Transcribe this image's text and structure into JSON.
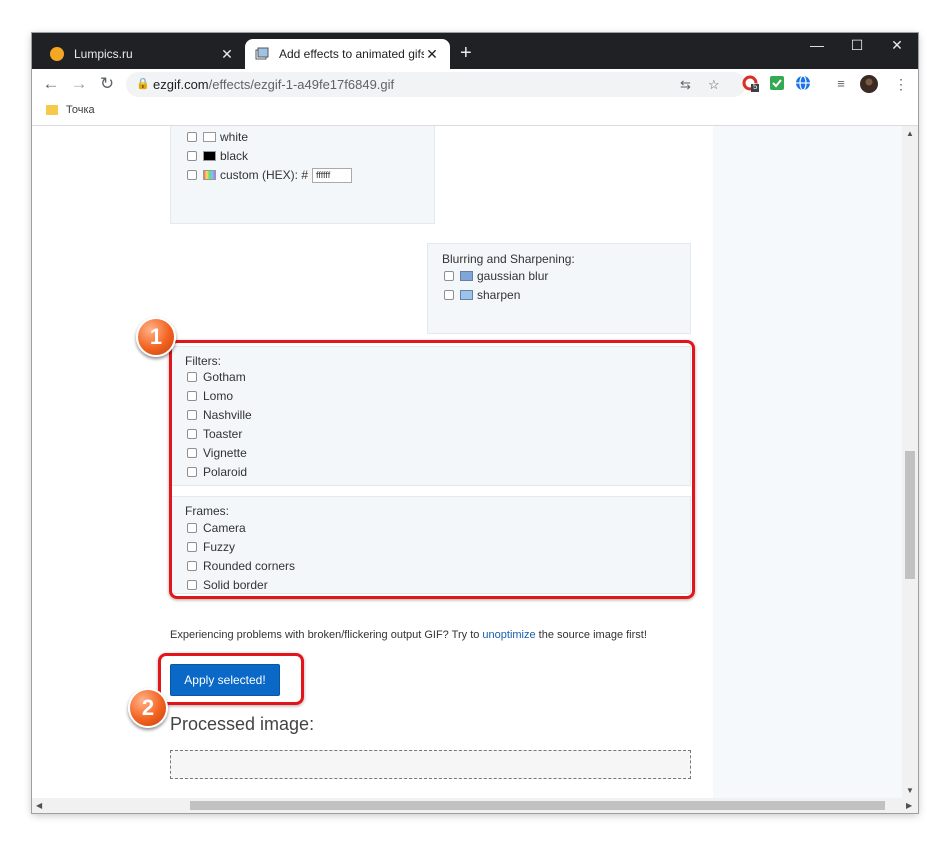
{
  "browser": {
    "tabs": [
      {
        "title": "Lumpics.ru",
        "close": "✕"
      },
      {
        "title": "Add effects to animated gifs - gif",
        "close": "✕"
      }
    ],
    "new_tab": "+",
    "window_controls": {
      "minimize": "—",
      "maximize": "☐",
      "close": "✕"
    },
    "nav": {
      "back": "←",
      "forward": "→",
      "reload": "↻"
    },
    "url_host": "ezgif.com",
    "url_path": "/effects/ezgif-1-a49fe17f6849.gif",
    "bookmark": "Точка",
    "extension_badge": "5"
  },
  "colors_panel": {
    "options": [
      {
        "label": "white",
        "swatch": "#ffffff"
      },
      {
        "label": "black",
        "swatch": "#000000"
      },
      {
        "label": "custom (HEX): #",
        "swatch": "gradient"
      }
    ],
    "hex_value": "ffffff"
  },
  "blur_panel": {
    "title": "Blurring and Sharpening:",
    "options": [
      "gaussian blur",
      "sharpen"
    ]
  },
  "filters": {
    "title": "Filters:",
    "options": [
      "Gotham",
      "Lomo",
      "Nashville",
      "Toaster",
      "Vignette",
      "Polaroid"
    ]
  },
  "frames": {
    "title": "Frames:",
    "options": [
      "Camera",
      "Fuzzy",
      "Rounded corners",
      "Solid border"
    ]
  },
  "note": {
    "before": "Experiencing problems with broken/flickering output GIF? Try to ",
    "link": "unoptimize",
    "after": " the source image first!"
  },
  "apply_button": "Apply selected!",
  "processed_heading": "Processed image:",
  "annotations": [
    "1",
    "2"
  ],
  "accent_colors": {
    "annotation_border": "#e3151a",
    "button": "#0a69c7",
    "badge": "#f2621f"
  }
}
